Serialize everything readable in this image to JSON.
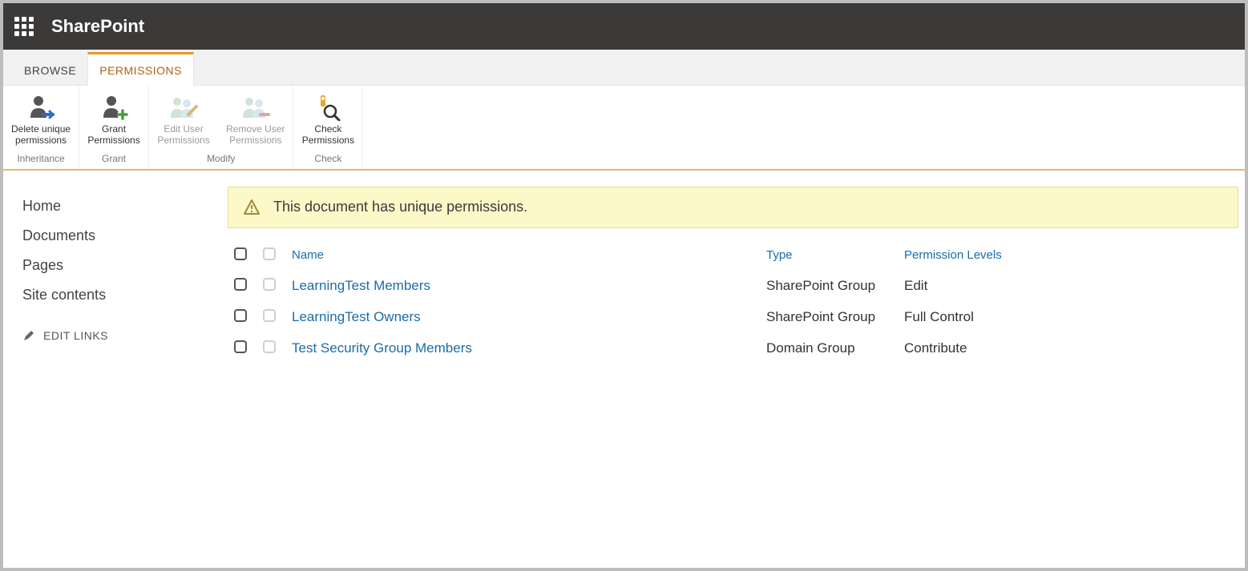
{
  "app_title": "SharePoint",
  "tabs": {
    "browse": "BROWSE",
    "permissions": "PERMISSIONS"
  },
  "ribbon": {
    "inheritance": {
      "label": "Inheritance",
      "delete_unique_line1": "Delete unique",
      "delete_unique_line2": "permissions"
    },
    "grant": {
      "label": "Grant",
      "grant_line1": "Grant",
      "grant_line2": "Permissions"
    },
    "modify": {
      "label": "Modify",
      "edit_user_line1": "Edit User",
      "edit_user_line2": "Permissions",
      "remove_user_line1": "Remove User",
      "remove_user_line2": "Permissions"
    },
    "check": {
      "label": "Check",
      "check_line1": "Check",
      "check_line2": "Permissions"
    }
  },
  "quick_launch": {
    "home": "Home",
    "documents": "Documents",
    "pages": "Pages",
    "site_contents": "Site contents",
    "edit_links": "EDIT LINKS"
  },
  "notice": "This document has unique permissions.",
  "table": {
    "headers": {
      "name": "Name",
      "type": "Type",
      "permission_levels": "Permission Levels"
    },
    "rows": [
      {
        "name": "LearningTest Members",
        "type": "SharePoint Group",
        "level": "Edit"
      },
      {
        "name": "LearningTest Owners",
        "type": "SharePoint Group",
        "level": "Full Control"
      },
      {
        "name": "Test Security Group Members",
        "type": "Domain Group",
        "level": "Contribute"
      }
    ]
  }
}
